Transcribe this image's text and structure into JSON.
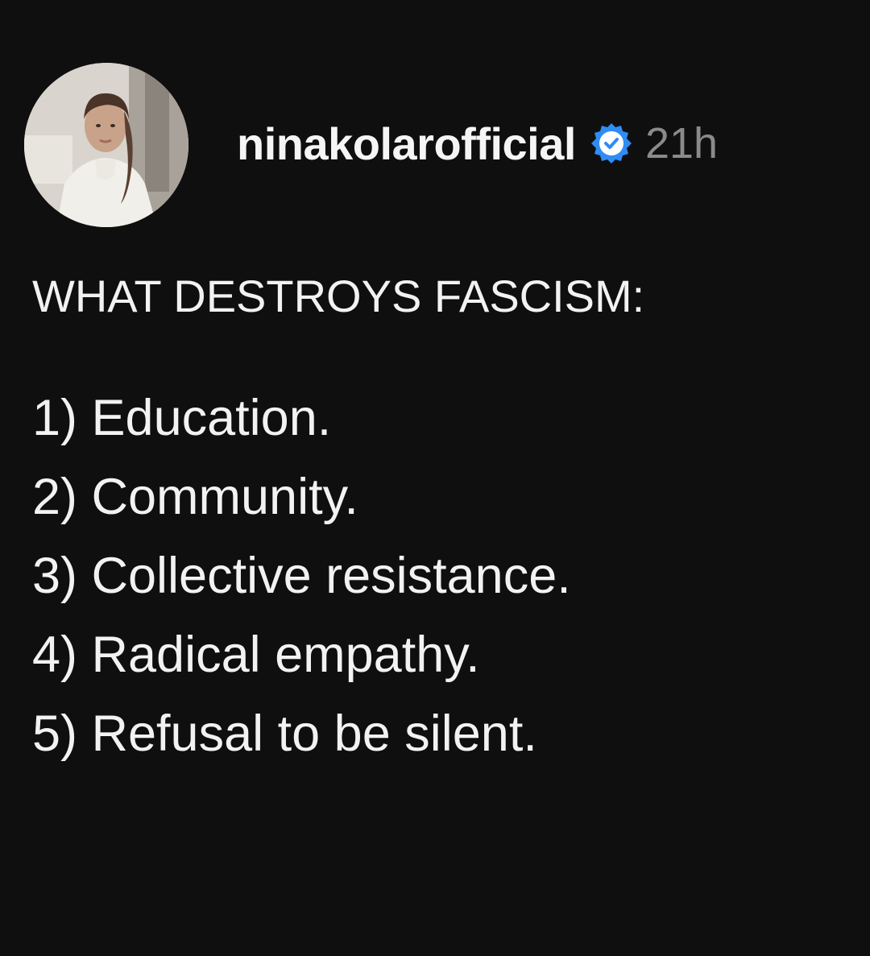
{
  "post": {
    "username": "ninakolarofficial",
    "verified_icon": "verified-badge-icon",
    "timestamp": "21h",
    "heading": "WHAT DESTROYS FASCISM:",
    "items": [
      "1) Education.",
      "2) Community.",
      "3) Collective resistance.",
      "4) Radical empathy.",
      "5) Refusal to be silent."
    ]
  },
  "colors": {
    "background": "#0f0f0f",
    "text": "#f2f2f2",
    "timestamp": "#8a8a8a",
    "verified_badge": "#2f8cf5"
  }
}
